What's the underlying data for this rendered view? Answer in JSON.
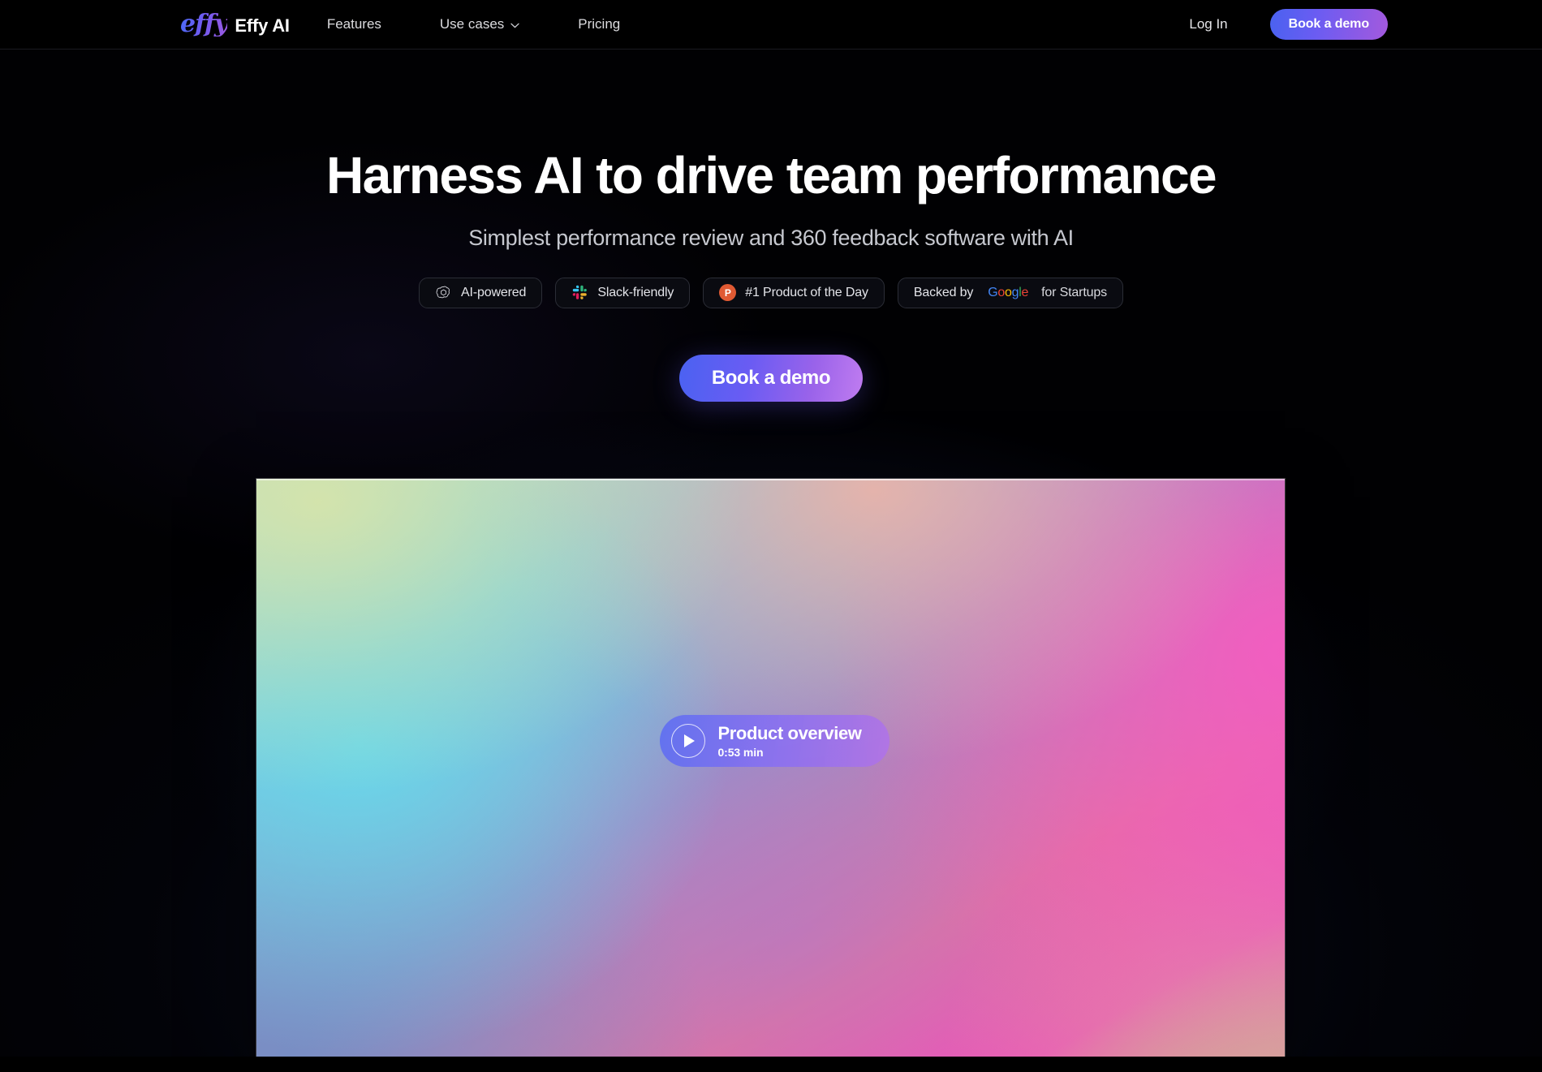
{
  "header": {
    "logo_mark": "effy",
    "logo_name": "Effy AI",
    "nav": [
      {
        "label": "Features",
        "icon": null
      },
      {
        "label": "Use cases",
        "icon": "chevron-down-icon"
      },
      {
        "label": "Pricing",
        "icon": null
      }
    ],
    "login_label": "Log In",
    "demo_label": "Book a demo"
  },
  "hero": {
    "headline": "Harness AI to drive team performance",
    "subhead": "Simplest performance review and 360 feedback software with AI",
    "cta_label": "Book a demo",
    "badges": [
      {
        "icon": "openai-icon",
        "label": "AI-powered"
      },
      {
        "icon": "slack-icon",
        "label": "Slack-friendly"
      },
      {
        "icon": "product-hunt-icon",
        "icon_letter": "P",
        "label": "#1 Product of the Day"
      },
      {
        "icon": "google-logo",
        "prefix": "Backed by",
        "google_letters": [
          "G",
          "o",
          "o",
          "g",
          "l",
          "e"
        ],
        "suffix": "for Startups"
      }
    ]
  },
  "video": {
    "play_icon": "play-icon",
    "title": "Product overview",
    "duration": "0:53 min"
  },
  "colors": {
    "accent_blue": "#4a62f2",
    "accent_purple": "#a359dd",
    "background": "#010103",
    "product_hunt": "#e05a33",
    "google_blue": "#4285F4",
    "google_red": "#EA4335",
    "google_yellow": "#FBBC05",
    "google_green": "#34A853"
  }
}
